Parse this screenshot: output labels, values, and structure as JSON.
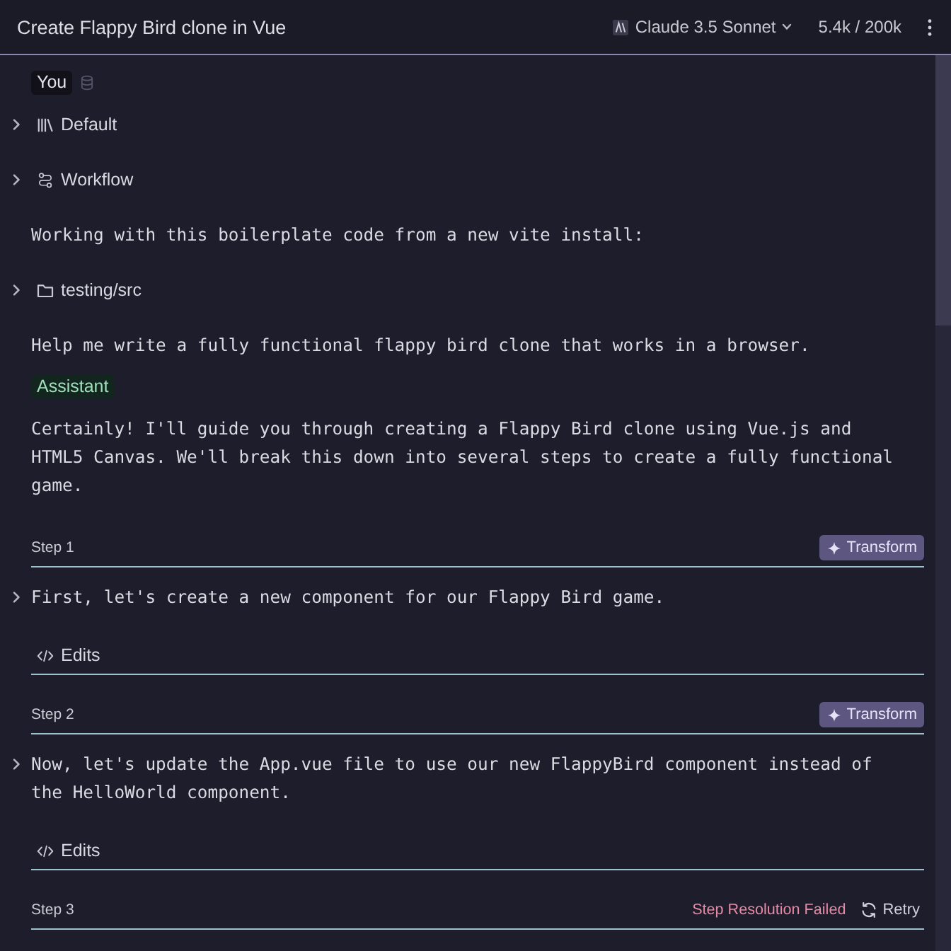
{
  "header": {
    "title": "Create Flappy Bird clone in Vue",
    "model": "Claude 3.5 Sonnet",
    "tokens": "5.4k / 200k"
  },
  "messages": [
    {
      "kind": "user",
      "label": "You",
      "blocks": [
        {
          "kind": "prompt",
          "label": "Default",
          "expanded": false
        },
        {
          "kind": "workflow",
          "label": "Workflow",
          "expanded": false
        },
        {
          "kind": "text",
          "text": "Working with this boilerplate code from a new vite install:"
        },
        {
          "kind": "folder",
          "label": "testing/src",
          "expanded": false
        },
        {
          "kind": "text",
          "text": "Help me write a fully functional flappy bird clone that works in a browser."
        }
      ]
    },
    {
      "kind": "assistant",
      "label": "Assistant",
      "blocks": [
        {
          "kind": "text",
          "text": "Certainly! I'll guide you through creating a Flappy Bird clone using Vue.js and HTML5 Canvas. We'll break this down into several steps to create a fully functional game."
        }
      ],
      "steps": [
        {
          "label": "Step 1",
          "action": {
            "kind": "transform",
            "label": "Transform"
          },
          "summary": "First, let's create a new component for our Flappy Bird game.",
          "expanded": false,
          "edits": "Edits"
        },
        {
          "label": "Step 2",
          "action": {
            "kind": "transform",
            "label": "Transform"
          },
          "summary": "Now, let's update the App.vue file to use our new FlappyBird component instead of the HelloWorld component.",
          "expanded": false,
          "edits": "Edits"
        },
        {
          "label": "Step 3",
          "status": "Step Resolution Failed",
          "action": {
            "kind": "retry",
            "label": "Retry"
          }
        }
      ]
    }
  ]
}
